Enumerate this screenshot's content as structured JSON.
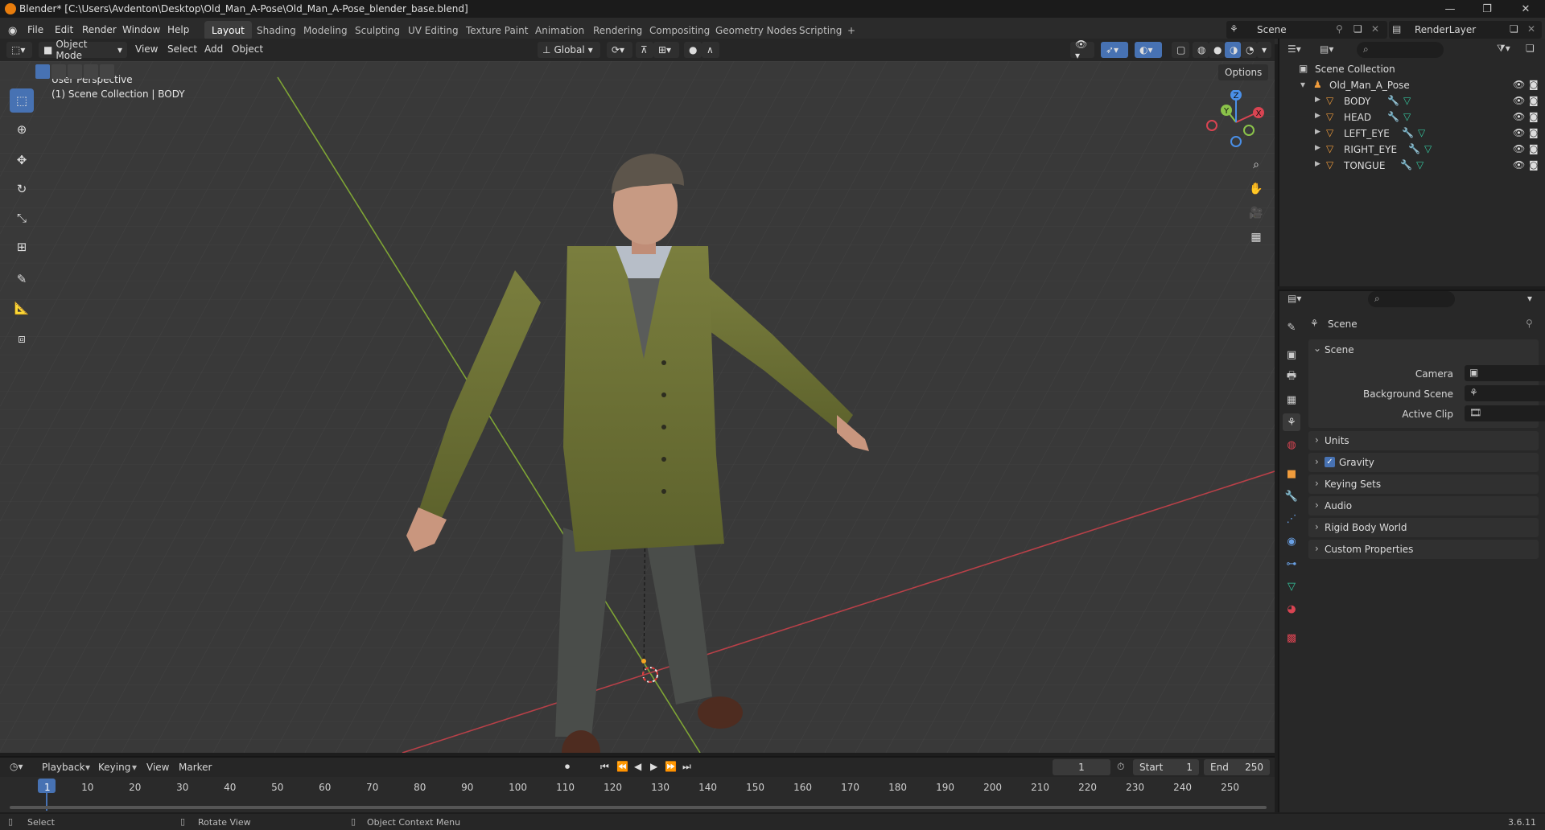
{
  "window": {
    "title": "Blender* [C:\\Users\\Avdenton\\Desktop\\Old_Man_A-Pose\\Old_Man_A-Pose_blender_base.blend]",
    "minimize": "—",
    "maximize": "❐",
    "close": "✕"
  },
  "menu": {
    "items": [
      "File",
      "Edit",
      "Render",
      "Window",
      "Help"
    ]
  },
  "workspaces": [
    "Layout",
    "Shading",
    "Modeling",
    "Sculpting",
    "UV Editing",
    "Texture Paint",
    "Animation",
    "Rendering",
    "Compositing",
    "Geometry Nodes",
    "Scripting"
  ],
  "workspace_add": "+",
  "scene_selector": {
    "value": "Scene"
  },
  "renderlayer_selector": {
    "value": "RenderLayer"
  },
  "viewport_header": {
    "mode": "Object Mode",
    "menus": [
      "View",
      "Select",
      "Add",
      "Object"
    ],
    "orientation": "Global",
    "options": "Options"
  },
  "viewport": {
    "perspective": "User Perspective",
    "collection": "(1) Scene Collection | BODY",
    "axis_labels": {
      "x": "X",
      "y": "Y",
      "z": "Z"
    }
  },
  "outliner": {
    "root": "Scene Collection",
    "collection": "Old_Man_A_Pose",
    "objects": [
      "BODY",
      "HEAD",
      "LEFT_EYE",
      "RIGHT_EYE",
      "TONGUE"
    ]
  },
  "properties": {
    "header": "Scene",
    "section": "Scene",
    "fields": [
      {
        "label": "Camera"
      },
      {
        "label": "Background Scene"
      },
      {
        "label": "Active Clip"
      }
    ],
    "panels": [
      "Units",
      "Gravity",
      "Keying Sets",
      "Audio",
      "Rigid Body World",
      "Custom Properties"
    ],
    "gravity_checked": true
  },
  "timeline": {
    "menus": [
      "Playback",
      "Keying",
      "View",
      "Marker"
    ],
    "current_frame": "1",
    "start_label": "Start",
    "start": "1",
    "end_label": "End",
    "end": "250",
    "ticks": [
      "1",
      "10",
      "20",
      "30",
      "40",
      "50",
      "60",
      "70",
      "80",
      "90",
      "100",
      "110",
      "120",
      "130",
      "140",
      "150",
      "160",
      "170",
      "180",
      "190",
      "200",
      "210",
      "220",
      "230",
      "240",
      "250"
    ]
  },
  "statusbar": {
    "select": "Select",
    "rotate": "Rotate View",
    "context": "Object Context Menu",
    "version": "3.6.11"
  },
  "colors": {
    "accent": "#4772b3",
    "x_axis": "#d94452",
    "y_axis": "#8bc34a",
    "z_axis": "#4a8fe7",
    "object_icon": "#f09c3c",
    "mesh_icon": "#35c79f"
  }
}
